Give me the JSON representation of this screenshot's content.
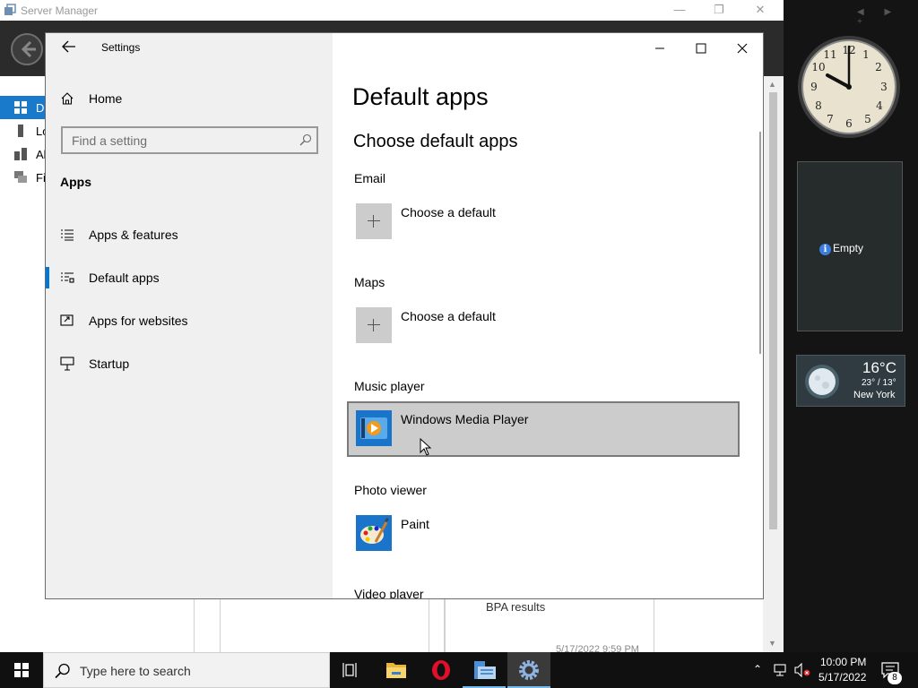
{
  "server_manager": {
    "title": "Server Manager",
    "nav_items": [
      "D",
      "Lo",
      "Al",
      "Fi"
    ],
    "bpa_label": "BPA results",
    "timestamp": "5/17/2022 9:59 PM"
  },
  "settings": {
    "window_title": "Settings",
    "home_label": "Home",
    "search_placeholder": "Find a setting",
    "section_label": "Apps",
    "nav": [
      {
        "label": "Apps & features",
        "icon": "apps-features-icon"
      },
      {
        "label": "Default apps",
        "icon": "default-apps-icon",
        "selected": true
      },
      {
        "label": "Apps for websites",
        "icon": "apps-websites-icon"
      },
      {
        "label": "Startup",
        "icon": "startup-icon"
      }
    ],
    "page_title": "Default apps",
    "page_subtitle": "Choose default apps",
    "categories": [
      {
        "label": "Email",
        "app": "Choose a default",
        "icon": "plus-icon"
      },
      {
        "label": "Maps",
        "app": "Choose a default",
        "icon": "plus-icon"
      },
      {
        "label": "Music player",
        "app": "Windows Media Player",
        "icon": "windows-media-player-icon",
        "hovered": true
      },
      {
        "label": "Photo viewer",
        "app": "Paint",
        "icon": "paint-icon"
      },
      {
        "label": "Video player",
        "app": "",
        "icon": ""
      }
    ]
  },
  "gadgets": {
    "slideshow_text": "Empty",
    "weather": {
      "temp": "16°C",
      "range": "23° / 13°",
      "city": "New York"
    },
    "clock_time": "10:00"
  },
  "taskbar": {
    "search_placeholder": "Type here to search",
    "time": "10:00 PM",
    "date": "5/17/2022",
    "notification_count": "8",
    "apps": [
      "task-view-icon",
      "file-explorer-icon",
      "opera-icon",
      "server-manager-icon",
      "settings-icon"
    ]
  },
  "colors": {
    "accent": "#0078d7",
    "hover_row": "#cccccc",
    "taskbar": "#101010"
  }
}
